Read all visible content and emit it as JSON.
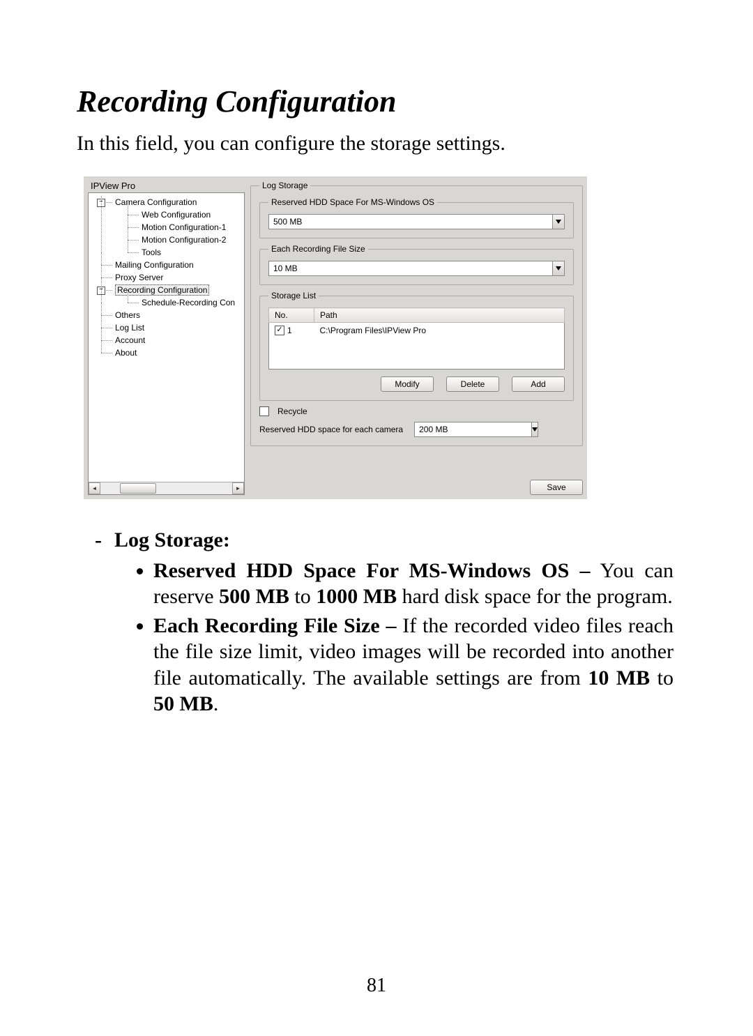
{
  "heading": "Recording Configuration",
  "intro": "In this field, you can configure the storage settings.",
  "page_number": "81",
  "shot": {
    "tree_title": "IPView Pro",
    "nodes": {
      "camera": "Camera Configuration",
      "web": "Web Configuration",
      "motion1": "Motion Configuration-1",
      "motion2": "Motion Configuration-2",
      "tools": "Tools",
      "mailing": "Mailing Configuration",
      "proxy": "Proxy Server",
      "recording": "Recording Configuration",
      "schedule": "Schedule-Recording Con",
      "others": "Others",
      "loglist": "Log List",
      "account": "Account",
      "about": "About",
      "minus": "−"
    },
    "log_storage_legend": "Log Storage",
    "reserved_legend": "Reserved HDD Space For MS-Windows OS",
    "reserved_value": "500 MB",
    "filesize_legend": "Each Recording File Size",
    "filesize_value": "10 MB",
    "storage_list_legend": "Storage List",
    "col_no": "No.",
    "col_path": "Path",
    "row_no": "1",
    "row_path": "C:\\Program Files\\IPView Pro",
    "btn_modify": "Modify",
    "btn_delete": "Delete",
    "btn_add": "Add",
    "recycle_label": "Recycle",
    "each_camera_label": "Reserved HDD space for each camera",
    "each_camera_value": "200 MB",
    "btn_save": "Save"
  },
  "body": {
    "log_storage_label": "Log Storage:",
    "b1_strong": "Reserved HDD Space For MS-Windows OS –",
    "b1_a": " You can reserve ",
    "b1_b": "500 MB",
    "b1_c": " to ",
    "b1_d": "1000 MB",
    "b1_e": " hard disk space for the program.",
    "b2_strong": "Each Recording File Size –",
    "b2_a": " If the recorded video files reach the file size limit, video images will be recorded into another file automatically.  The available settings are from ",
    "b2_b": "10 MB",
    "b2_c": " to ",
    "b2_d": "50 MB",
    "b2_e": "."
  }
}
